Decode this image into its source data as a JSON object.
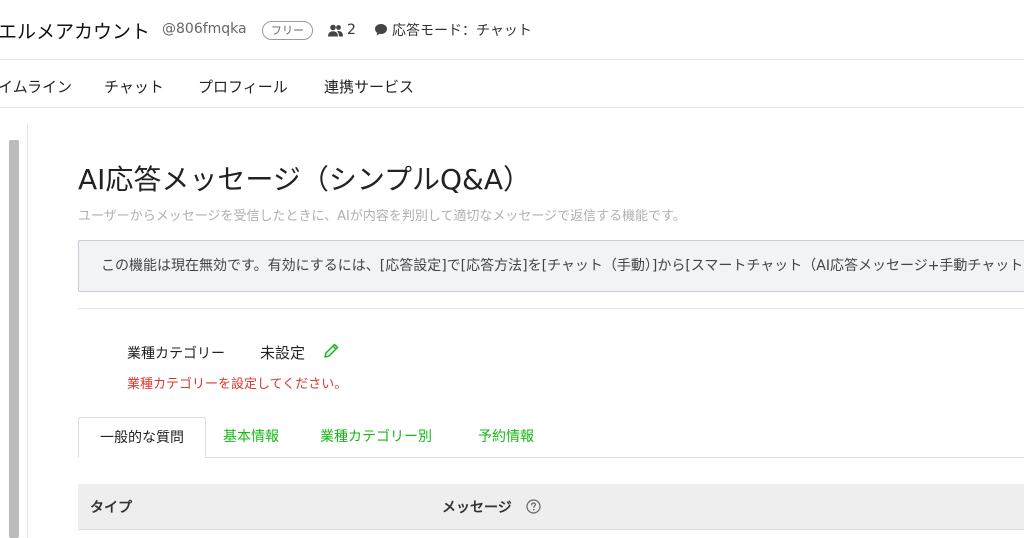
{
  "header": {
    "account_name": "エルメアカウント",
    "account_id": "@806fmqka",
    "plan_badge": "フリー",
    "friends_count": "2",
    "mode_text": "応答モード：チャット"
  },
  "nav": {
    "items": [
      "イムライン",
      "チャット",
      "プロフィール",
      "連携サービス"
    ]
  },
  "main": {
    "title": "AI応答メッセージ（シンプルQ&A）",
    "description": "ユーザーからメッセージを受信したときに、AIが内容を判別して適切なメッセージで返信する機能です。",
    "notice": "この機能は現在無効です。有効にするには、[応答設定]で[応答方法]を[チャット（手動）]から[スマートチャット（AI応答メッセージ+手動チャット）]に変更してください。",
    "category_label": "業種カテゴリー",
    "category_value": "未設定",
    "category_error": "業種カテゴリーを設定してください。",
    "tabs": [
      "一般的な質問",
      "基本情報",
      "業種カテゴリー別",
      "予約情報"
    ],
    "table_headers": {
      "type": "タイプ",
      "message": "メッセージ"
    }
  },
  "colors": {
    "accent_green": "#16b816",
    "error_red": "#e0362f",
    "notice_bg": "#f1f3f6"
  }
}
